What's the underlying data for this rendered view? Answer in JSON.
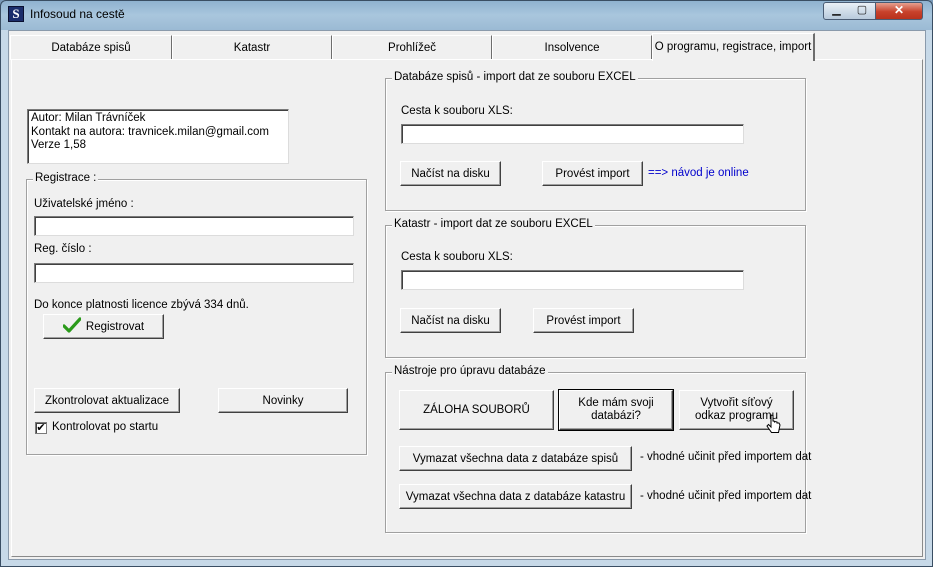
{
  "window": {
    "title": "Infosoud na cestě",
    "app_icon_letter": "S",
    "minimize": "▁",
    "maximize": "▢",
    "close": "✕"
  },
  "tabs": [
    {
      "label": "Databáze spisů"
    },
    {
      "label": "Katastr"
    },
    {
      "label": "Prohlížeč"
    },
    {
      "label": "Insolvence"
    },
    {
      "label": "O programu, registrace, import"
    }
  ],
  "about": {
    "author": "Autor: Milan Trávníček",
    "contact": "Kontakt na autora: travnicek.milan@gmail.com",
    "version": "Verze 1,58"
  },
  "registration": {
    "legend": "Registrace :",
    "username_label": "Uživatelské jméno :",
    "username_value": "",
    "regnum_label": "Reg. číslo :",
    "regnum_value": "",
    "license_text": "Do konce platnosti licence zbývá 334 dnů.",
    "register_button": "Registrovat",
    "check_updates_button": "Zkontrolovat aktualizace",
    "news_button": "Novinky",
    "check_on_start_label": "Kontrolovat po startu",
    "check_on_start_mark": "✔"
  },
  "import_spisy": {
    "legend": "Databáze spisů - import dat ze souboru EXCEL",
    "path_label": "Cesta k souboru XLS:",
    "path_value": "",
    "load_button": "Načíst na disku",
    "import_button": "Provést import",
    "guide_link": "==> návod je online"
  },
  "import_katastr": {
    "legend": "Katastr - import dat ze souboru EXCEL",
    "path_label": "Cesta k souboru XLS:",
    "path_value": "",
    "load_button": "Načíst na disku",
    "import_button": "Provést import"
  },
  "tools": {
    "legend": "Nástroje pro úpravu databáze",
    "backup_button": "ZÁLOHA SOUBORŮ",
    "where_db_button": "Kde mám svoji databázi?",
    "shortcut_button": "Vytvořit síťový odkaz programu",
    "delete_spisy_button": "Vymazat všechna data z databáze spisů",
    "delete_spisy_note": "- vhodné učinit před importem dat",
    "delete_katastr_button": "Vymazat všechna data z databáze katastru",
    "delete_katastr_note": "- vhodné učinit před importem dat"
  },
  "colors": {
    "link": "#0000cc",
    "check_green": "#2a9a1a",
    "title_gradient": "#a9c6dd"
  }
}
